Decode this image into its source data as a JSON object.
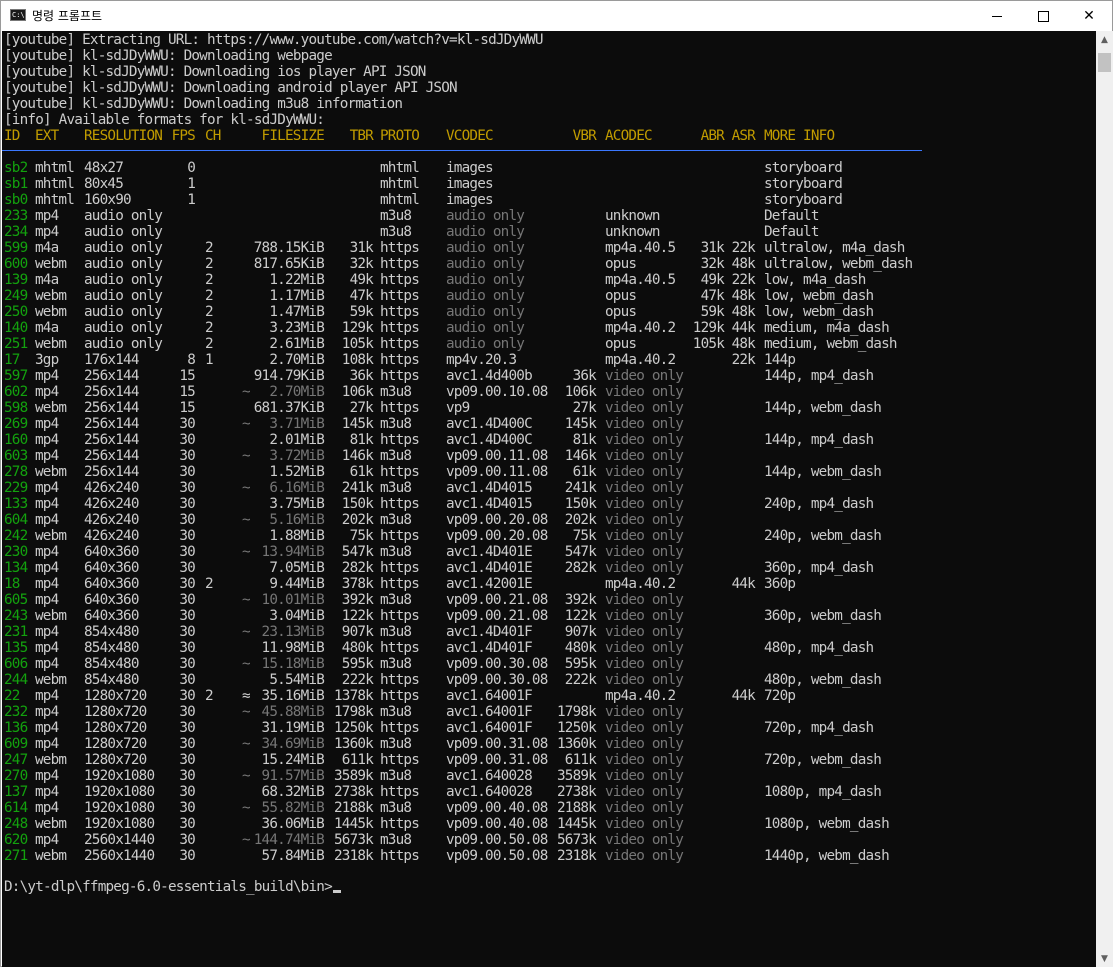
{
  "window": {
    "title": "명령 프롬프트",
    "icon": "console-app-icon",
    "minimize": "minimize",
    "maximize": "maximize",
    "close": "close"
  },
  "log": [
    "[youtube] Extracting URL: https://www.youtube.com/watch?v=kl-sdJDyWWU",
    "[youtube] kl-sdJDyWWU: Downloading webpage",
    "[youtube] kl-sdJDyWWU: Downloading ios player API JSON",
    "[youtube] kl-sdJDyWWU: Downloading android player API JSON",
    "[youtube] kl-sdJDyWWU: Downloading m3u8 information",
    "[info] Available formats for kl-sdJDyWWU:"
  ],
  "headers": {
    "id": "ID",
    "ext": "EXT",
    "resolution": "RESOLUTION",
    "fps": "FPS",
    "ch": "CH",
    "filesize": "FILESIZE",
    "tbr": "TBR",
    "proto": "PROTO",
    "vcodec": "VCODEC",
    "vbr": "VBR",
    "acodec": "ACODEC",
    "abr": "ABR",
    "asr": "ASR",
    "more": "MORE INFO"
  },
  "formats": [
    {
      "id": "sb2",
      "ext": "mhtml",
      "res": "48x27",
      "fps": "0",
      "ch": "",
      "approx": "",
      "size": "",
      "tbr": "",
      "proto": "mhtml",
      "vcodec": "images",
      "vdim": false,
      "vbr": "",
      "acodec": "",
      "adim": false,
      "abr": "",
      "asr": "",
      "more": "storyboard"
    },
    {
      "id": "sb1",
      "ext": "mhtml",
      "res": "80x45",
      "fps": "1",
      "ch": "",
      "approx": "",
      "size": "",
      "tbr": "",
      "proto": "mhtml",
      "vcodec": "images",
      "vdim": false,
      "vbr": "",
      "acodec": "",
      "adim": false,
      "abr": "",
      "asr": "",
      "more": "storyboard"
    },
    {
      "id": "sb0",
      "ext": "mhtml",
      "res": "160x90",
      "fps": "1",
      "ch": "",
      "approx": "",
      "size": "",
      "tbr": "",
      "proto": "mhtml",
      "vcodec": "images",
      "vdim": false,
      "vbr": "",
      "acodec": "",
      "adim": false,
      "abr": "",
      "asr": "",
      "more": "storyboard"
    },
    {
      "id": "233",
      "ext": "mp4",
      "res": "audio only",
      "fps": "",
      "ch": "",
      "approx": "",
      "size": "",
      "tbr": "",
      "proto": "m3u8",
      "vcodec": "audio only",
      "vdim": true,
      "vbr": "",
      "acodec": "unknown",
      "adim": false,
      "abr": "",
      "asr": "",
      "more": "Default"
    },
    {
      "id": "234",
      "ext": "mp4",
      "res": "audio only",
      "fps": "",
      "ch": "",
      "approx": "",
      "size": "",
      "tbr": "",
      "proto": "m3u8",
      "vcodec": "audio only",
      "vdim": true,
      "vbr": "",
      "acodec": "unknown",
      "adim": false,
      "abr": "",
      "asr": "",
      "more": "Default"
    },
    {
      "id": "599",
      "ext": "m4a",
      "res": "audio only",
      "fps": "",
      "ch": "2",
      "approx": "",
      "size": "788.15KiB",
      "tbr": "31k",
      "proto": "https",
      "vcodec": "audio only",
      "vdim": true,
      "vbr": "",
      "acodec": "mp4a.40.5",
      "adim": false,
      "abr": "31k",
      "asr": "22k",
      "more": "ultralow, m4a_dash"
    },
    {
      "id": "600",
      "ext": "webm",
      "res": "audio only",
      "fps": "",
      "ch": "2",
      "approx": "",
      "size": "817.65KiB",
      "tbr": "32k",
      "proto": "https",
      "vcodec": "audio only",
      "vdim": true,
      "vbr": "",
      "acodec": "opus",
      "adim": false,
      "abr": "32k",
      "asr": "48k",
      "more": "ultralow, webm_dash"
    },
    {
      "id": "139",
      "ext": "m4a",
      "res": "audio only",
      "fps": "",
      "ch": "2",
      "approx": "",
      "size": "1.22MiB",
      "tbr": "49k",
      "proto": "https",
      "vcodec": "audio only",
      "vdim": true,
      "vbr": "",
      "acodec": "mp4a.40.5",
      "adim": false,
      "abr": "49k",
      "asr": "22k",
      "more": "low, m4a_dash"
    },
    {
      "id": "249",
      "ext": "webm",
      "res": "audio only",
      "fps": "",
      "ch": "2",
      "approx": "",
      "size": "1.17MiB",
      "tbr": "47k",
      "proto": "https",
      "vcodec": "audio only",
      "vdim": true,
      "vbr": "",
      "acodec": "opus",
      "adim": false,
      "abr": "47k",
      "asr": "48k",
      "more": "low, webm_dash"
    },
    {
      "id": "250",
      "ext": "webm",
      "res": "audio only",
      "fps": "",
      "ch": "2",
      "approx": "",
      "size": "1.47MiB",
      "tbr": "59k",
      "proto": "https",
      "vcodec": "audio only",
      "vdim": true,
      "vbr": "",
      "acodec": "opus",
      "adim": false,
      "abr": "59k",
      "asr": "48k",
      "more": "low, webm_dash"
    },
    {
      "id": "140",
      "ext": "m4a",
      "res": "audio only",
      "fps": "",
      "ch": "2",
      "approx": "",
      "size": "3.23MiB",
      "tbr": "129k",
      "proto": "https",
      "vcodec": "audio only",
      "vdim": true,
      "vbr": "",
      "acodec": "mp4a.40.2",
      "adim": false,
      "abr": "129k",
      "asr": "44k",
      "more": "medium, m4a_dash"
    },
    {
      "id": "251",
      "ext": "webm",
      "res": "audio only",
      "fps": "",
      "ch": "2",
      "approx": "",
      "size": "2.61MiB",
      "tbr": "105k",
      "proto": "https",
      "vcodec": "audio only",
      "vdim": true,
      "vbr": "",
      "acodec": "opus",
      "adim": false,
      "abr": "105k",
      "asr": "48k",
      "more": "medium, webm_dash"
    },
    {
      "id": "17",
      "ext": "3gp",
      "res": "176x144",
      "fps": "8",
      "ch": "1",
      "approx": "",
      "size": "2.70MiB",
      "tbr": "108k",
      "proto": "https",
      "vcodec": "mp4v.20.3",
      "vdim": false,
      "vbr": "",
      "acodec": "mp4a.40.2",
      "adim": false,
      "abr": "",
      "asr": "22k",
      "more": "144p"
    },
    {
      "id": "597",
      "ext": "mp4",
      "res": "256x144",
      "fps": "15",
      "ch": "",
      "approx": "",
      "size": "914.79KiB",
      "tbr": "36k",
      "proto": "https",
      "vcodec": "avc1.4d400b",
      "vdim": false,
      "vbr": "36k",
      "acodec": "video only",
      "adim": true,
      "abr": "",
      "asr": "",
      "more": "144p, mp4_dash"
    },
    {
      "id": "602",
      "ext": "mp4",
      "res": "256x144",
      "fps": "15",
      "ch": "",
      "approx": "~",
      "size": "2.70MiB",
      "tbr": "106k",
      "proto": "m3u8",
      "vcodec": "vp09.00.10.08",
      "vdim": false,
      "vbr": "106k",
      "acodec": "video only",
      "adim": true,
      "abr": "",
      "asr": "",
      "more": ""
    },
    {
      "id": "598",
      "ext": "webm",
      "res": "256x144",
      "fps": "15",
      "ch": "",
      "approx": "",
      "size": "681.37KiB",
      "tbr": "27k",
      "proto": "https",
      "vcodec": "vp9",
      "vdim": false,
      "vbr": "27k",
      "acodec": "video only",
      "adim": true,
      "abr": "",
      "asr": "",
      "more": "144p, webm_dash"
    },
    {
      "id": "269",
      "ext": "mp4",
      "res": "256x144",
      "fps": "30",
      "ch": "",
      "approx": "~",
      "size": "3.71MiB",
      "tbr": "145k",
      "proto": "m3u8",
      "vcodec": "avc1.4D400C",
      "vdim": false,
      "vbr": "145k",
      "acodec": "video only",
      "adim": true,
      "abr": "",
      "asr": "",
      "more": ""
    },
    {
      "id": "160",
      "ext": "mp4",
      "res": "256x144",
      "fps": "30",
      "ch": "",
      "approx": "",
      "size": "2.01MiB",
      "tbr": "81k",
      "proto": "https",
      "vcodec": "avc1.4D400C",
      "vdim": false,
      "vbr": "81k",
      "acodec": "video only",
      "adim": true,
      "abr": "",
      "asr": "",
      "more": "144p, mp4_dash"
    },
    {
      "id": "603",
      "ext": "mp4",
      "res": "256x144",
      "fps": "30",
      "ch": "",
      "approx": "~",
      "size": "3.72MiB",
      "tbr": "146k",
      "proto": "m3u8",
      "vcodec": "vp09.00.11.08",
      "vdim": false,
      "vbr": "146k",
      "acodec": "video only",
      "adim": true,
      "abr": "",
      "asr": "",
      "more": ""
    },
    {
      "id": "278",
      "ext": "webm",
      "res": "256x144",
      "fps": "30",
      "ch": "",
      "approx": "",
      "size": "1.52MiB",
      "tbr": "61k",
      "proto": "https",
      "vcodec": "vp09.00.11.08",
      "vdim": false,
      "vbr": "61k",
      "acodec": "video only",
      "adim": true,
      "abr": "",
      "asr": "",
      "more": "144p, webm_dash"
    },
    {
      "id": "229",
      "ext": "mp4",
      "res": "426x240",
      "fps": "30",
      "ch": "",
      "approx": "~",
      "size": "6.16MiB",
      "tbr": "241k",
      "proto": "m3u8",
      "vcodec": "avc1.4D4015",
      "vdim": false,
      "vbr": "241k",
      "acodec": "video only",
      "adim": true,
      "abr": "",
      "asr": "",
      "more": ""
    },
    {
      "id": "133",
      "ext": "mp4",
      "res": "426x240",
      "fps": "30",
      "ch": "",
      "approx": "",
      "size": "3.75MiB",
      "tbr": "150k",
      "proto": "https",
      "vcodec": "avc1.4D4015",
      "vdim": false,
      "vbr": "150k",
      "acodec": "video only",
      "adim": true,
      "abr": "",
      "asr": "",
      "more": "240p, mp4_dash"
    },
    {
      "id": "604",
      "ext": "mp4",
      "res": "426x240",
      "fps": "30",
      "ch": "",
      "approx": "~",
      "size": "5.16MiB",
      "tbr": "202k",
      "proto": "m3u8",
      "vcodec": "vp09.00.20.08",
      "vdim": false,
      "vbr": "202k",
      "acodec": "video only",
      "adim": true,
      "abr": "",
      "asr": "",
      "more": ""
    },
    {
      "id": "242",
      "ext": "webm",
      "res": "426x240",
      "fps": "30",
      "ch": "",
      "approx": "",
      "size": "1.88MiB",
      "tbr": "75k",
      "proto": "https",
      "vcodec": "vp09.00.20.08",
      "vdim": false,
      "vbr": "75k",
      "acodec": "video only",
      "adim": true,
      "abr": "",
      "asr": "",
      "more": "240p, webm_dash"
    },
    {
      "id": "230",
      "ext": "mp4",
      "res": "640x360",
      "fps": "30",
      "ch": "",
      "approx": "~",
      "size": "13.94MiB",
      "tbr": "547k",
      "proto": "m3u8",
      "vcodec": "avc1.4D401E",
      "vdim": false,
      "vbr": "547k",
      "acodec": "video only",
      "adim": true,
      "abr": "",
      "asr": "",
      "more": ""
    },
    {
      "id": "134",
      "ext": "mp4",
      "res": "640x360",
      "fps": "30",
      "ch": "",
      "approx": "",
      "size": "7.05MiB",
      "tbr": "282k",
      "proto": "https",
      "vcodec": "avc1.4D401E",
      "vdim": false,
      "vbr": "282k",
      "acodec": "video only",
      "adim": true,
      "abr": "",
      "asr": "",
      "more": "360p, mp4_dash"
    },
    {
      "id": "18",
      "ext": "mp4",
      "res": "640x360",
      "fps": "30",
      "ch": "2",
      "approx": "",
      "size": "9.44MiB",
      "tbr": "378k",
      "proto": "https",
      "vcodec": "avc1.42001E",
      "vdim": false,
      "vbr": "",
      "acodec": "mp4a.40.2",
      "adim": false,
      "abr": "",
      "asr": "44k",
      "more": "360p"
    },
    {
      "id": "605",
      "ext": "mp4",
      "res": "640x360",
      "fps": "30",
      "ch": "",
      "approx": "~",
      "size": "10.01MiB",
      "tbr": "392k",
      "proto": "m3u8",
      "vcodec": "vp09.00.21.08",
      "vdim": false,
      "vbr": "392k",
      "acodec": "video only",
      "adim": true,
      "abr": "",
      "asr": "",
      "more": ""
    },
    {
      "id": "243",
      "ext": "webm",
      "res": "640x360",
      "fps": "30",
      "ch": "",
      "approx": "",
      "size": "3.04MiB",
      "tbr": "122k",
      "proto": "https",
      "vcodec": "vp09.00.21.08",
      "vdim": false,
      "vbr": "122k",
      "acodec": "video only",
      "adim": true,
      "abr": "",
      "asr": "",
      "more": "360p, webm_dash"
    },
    {
      "id": "231",
      "ext": "mp4",
      "res": "854x480",
      "fps": "30",
      "ch": "",
      "approx": "~",
      "size": "23.13MiB",
      "tbr": "907k",
      "proto": "m3u8",
      "vcodec": "avc1.4D401F",
      "vdim": false,
      "vbr": "907k",
      "acodec": "video only",
      "adim": true,
      "abr": "",
      "asr": "",
      "more": ""
    },
    {
      "id": "135",
      "ext": "mp4",
      "res": "854x480",
      "fps": "30",
      "ch": "",
      "approx": "",
      "size": "11.98MiB",
      "tbr": "480k",
      "proto": "https",
      "vcodec": "avc1.4D401F",
      "vdim": false,
      "vbr": "480k",
      "acodec": "video only",
      "adim": true,
      "abr": "",
      "asr": "",
      "more": "480p, mp4_dash"
    },
    {
      "id": "606",
      "ext": "mp4",
      "res": "854x480",
      "fps": "30",
      "ch": "",
      "approx": "~",
      "size": "15.18MiB",
      "tbr": "595k",
      "proto": "m3u8",
      "vcodec": "vp09.00.30.08",
      "vdim": false,
      "vbr": "595k",
      "acodec": "video only",
      "adim": true,
      "abr": "",
      "asr": "",
      "more": ""
    },
    {
      "id": "244",
      "ext": "webm",
      "res": "854x480",
      "fps": "30",
      "ch": "",
      "approx": "",
      "size": "5.54MiB",
      "tbr": "222k",
      "proto": "https",
      "vcodec": "vp09.00.30.08",
      "vdim": false,
      "vbr": "222k",
      "acodec": "video only",
      "adim": true,
      "abr": "",
      "asr": "",
      "more": "480p, webm_dash"
    },
    {
      "id": "22",
      "ext": "mp4",
      "res": "1280x720",
      "fps": "30",
      "ch": "2",
      "approx": "≈",
      "size": "35.16MiB",
      "tbr": "1378k",
      "proto": "https",
      "vcodec": "avc1.64001F",
      "vdim": false,
      "vbr": "",
      "acodec": "mp4a.40.2",
      "adim": false,
      "abr": "",
      "asr": "44k",
      "more": "720p",
      "sizeNormal": true
    },
    {
      "id": "232",
      "ext": "mp4",
      "res": "1280x720",
      "fps": "30",
      "ch": "",
      "approx": "~",
      "size": "45.88MiB",
      "tbr": "1798k",
      "proto": "m3u8",
      "vcodec": "avc1.64001F",
      "vdim": false,
      "vbr": "1798k",
      "acodec": "video only",
      "adim": true,
      "abr": "",
      "asr": "",
      "more": ""
    },
    {
      "id": "136",
      "ext": "mp4",
      "res": "1280x720",
      "fps": "30",
      "ch": "",
      "approx": "",
      "size": "31.19MiB",
      "tbr": "1250k",
      "proto": "https",
      "vcodec": "avc1.64001F",
      "vdim": false,
      "vbr": "1250k",
      "acodec": "video only",
      "adim": true,
      "abr": "",
      "asr": "",
      "more": "720p, mp4_dash"
    },
    {
      "id": "609",
      "ext": "mp4",
      "res": "1280x720",
      "fps": "30",
      "ch": "",
      "approx": "~",
      "size": "34.69MiB",
      "tbr": "1360k",
      "proto": "m3u8",
      "vcodec": "vp09.00.31.08",
      "vdim": false,
      "vbr": "1360k",
      "acodec": "video only",
      "adim": true,
      "abr": "",
      "asr": "",
      "more": ""
    },
    {
      "id": "247",
      "ext": "webm",
      "res": "1280x720",
      "fps": "30",
      "ch": "",
      "approx": "",
      "size": "15.24MiB",
      "tbr": "611k",
      "proto": "https",
      "vcodec": "vp09.00.31.08",
      "vdim": false,
      "vbr": "611k",
      "acodec": "video only",
      "adim": true,
      "abr": "",
      "asr": "",
      "more": "720p, webm_dash"
    },
    {
      "id": "270",
      "ext": "mp4",
      "res": "1920x1080",
      "fps": "30",
      "ch": "",
      "approx": "~",
      "size": "91.57MiB",
      "tbr": "3589k",
      "proto": "m3u8",
      "vcodec": "avc1.640028",
      "vdim": false,
      "vbr": "3589k",
      "acodec": "video only",
      "adim": true,
      "abr": "",
      "asr": "",
      "more": ""
    },
    {
      "id": "137",
      "ext": "mp4",
      "res": "1920x1080",
      "fps": "30",
      "ch": "",
      "approx": "",
      "size": "68.32MiB",
      "tbr": "2738k",
      "proto": "https",
      "vcodec": "avc1.640028",
      "vdim": false,
      "vbr": "2738k",
      "acodec": "video only",
      "adim": true,
      "abr": "",
      "asr": "",
      "more": "1080p, mp4_dash"
    },
    {
      "id": "614",
      "ext": "mp4",
      "res": "1920x1080",
      "fps": "30",
      "ch": "",
      "approx": "~",
      "size": "55.82MiB",
      "tbr": "2188k",
      "proto": "m3u8",
      "vcodec": "vp09.00.40.08",
      "vdim": false,
      "vbr": "2188k",
      "acodec": "video only",
      "adim": true,
      "abr": "",
      "asr": "",
      "more": ""
    },
    {
      "id": "248",
      "ext": "webm",
      "res": "1920x1080",
      "fps": "30",
      "ch": "",
      "approx": "",
      "size": "36.06MiB",
      "tbr": "1445k",
      "proto": "https",
      "vcodec": "vp09.00.40.08",
      "vdim": false,
      "vbr": "1445k",
      "acodec": "video only",
      "adim": true,
      "abr": "",
      "asr": "",
      "more": "1080p, webm_dash"
    },
    {
      "id": "620",
      "ext": "mp4",
      "res": "2560x1440",
      "fps": "30",
      "ch": "",
      "approx": "~",
      "size": "144.74MiB",
      "tbr": "5673k",
      "proto": "m3u8",
      "vcodec": "vp09.00.50.08",
      "vdim": false,
      "vbr": "5673k",
      "acodec": "video only",
      "adim": true,
      "abr": "",
      "asr": "",
      "more": ""
    },
    {
      "id": "271",
      "ext": "webm",
      "res": "2560x1440",
      "fps": "30",
      "ch": "",
      "approx": "",
      "size": "57.84MiB",
      "tbr": "2318k",
      "proto": "https",
      "vcodec": "vp09.00.50.08",
      "vdim": false,
      "vbr": "2318k",
      "acodec": "video only",
      "adim": true,
      "abr": "",
      "asr": "",
      "more": "1440p, webm_dash"
    }
  ],
  "prompt": "D:\\yt-dlp\\ffmpeg-6.0-essentials_build\\bin>",
  "colors": {
    "console_bg": "#0c0c0c",
    "text": "#cccccc",
    "header": "#c19c00",
    "id": "#13a10e",
    "dim": "#767676",
    "separator": "#3b78ff"
  }
}
